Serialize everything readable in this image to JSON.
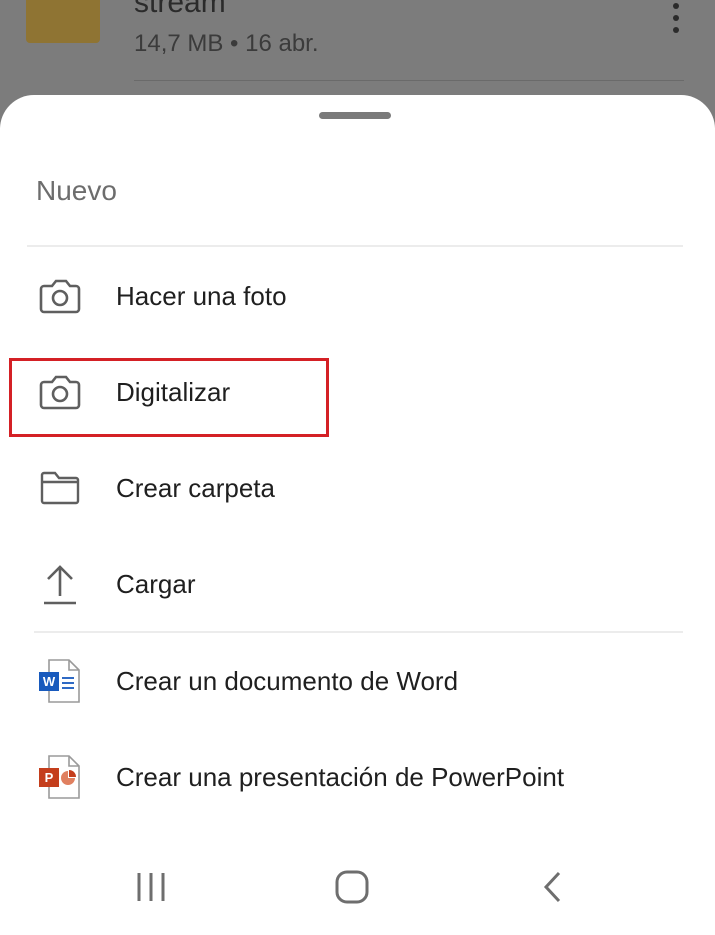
{
  "background": {
    "file_name": "stream",
    "file_meta": "14,7 MB • 16 abr.",
    "more_icon": "more-vertical-icon",
    "folder_icon": "folder-icon"
  },
  "sheet": {
    "title": "Nuevo",
    "items": [
      {
        "label": "Hacer una foto",
        "icon": "camera-icon"
      },
      {
        "label": "Digitalizar",
        "icon": "camera-icon"
      },
      {
        "label": "Crear carpeta",
        "icon": "folder-outline-icon"
      },
      {
        "label": "Cargar",
        "icon": "upload-icon"
      },
      {
        "label": "Crear un documento de Word",
        "icon": "word-document-icon"
      },
      {
        "label": "Crear una presentación de PowerPoint",
        "icon": "powerpoint-icon"
      }
    ],
    "highlight_color": "#d42025"
  },
  "navbar": {
    "recent_icon": "recent-apps-icon",
    "home_icon": "home-icon",
    "back_icon": "back-icon"
  },
  "colors": {
    "word_blue": "#185abd",
    "powerpoint_red": "#c43e1c"
  }
}
